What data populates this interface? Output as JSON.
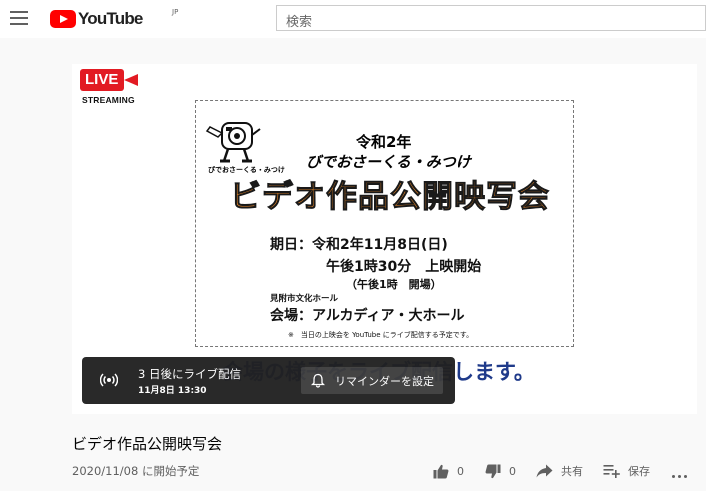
{
  "header": {
    "logo_text": "YouTube",
    "logo_region": "JP",
    "search_placeholder": "検索"
  },
  "player": {
    "live_badge": "LIVE",
    "streaming_label": "STREAMING",
    "poster": {
      "mascot_caption": "ぴでおさーくる・みつけ",
      "reiwa": "令和2年",
      "group": "びでおさーくる・みつけ",
      "title": "ビデオ作品公開映写会",
      "date": "期日：令和2年11月8日(日)",
      "time": "午後1時30分　上映開始",
      "open": "（午後1時　開場）",
      "hall": "見附市文化ホール",
      "venue": "会場：アルカディア・大ホール",
      "note": "※　当日の上映会を YouTube にライブ配信する予定です。"
    },
    "subtitle": "会場の様子をライブ配信します。",
    "live_card": {
      "countdown": "3 日後にライブ配信",
      "datetime": "11月8日 13:30",
      "reminder_label": "リマインダーを設定"
    }
  },
  "video": {
    "title": "ビデオ作品公開映写会",
    "schedule": "2020/11/08 に開始予定",
    "likes": "0",
    "dislikes": "0",
    "share_label": "共有",
    "save_label": "保存"
  },
  "colors": {
    "brand_red": "#ff0000",
    "live_red": "#e21b23",
    "title_orange": "#f28c28",
    "subtitle_blue": "#1f3a8a"
  }
}
